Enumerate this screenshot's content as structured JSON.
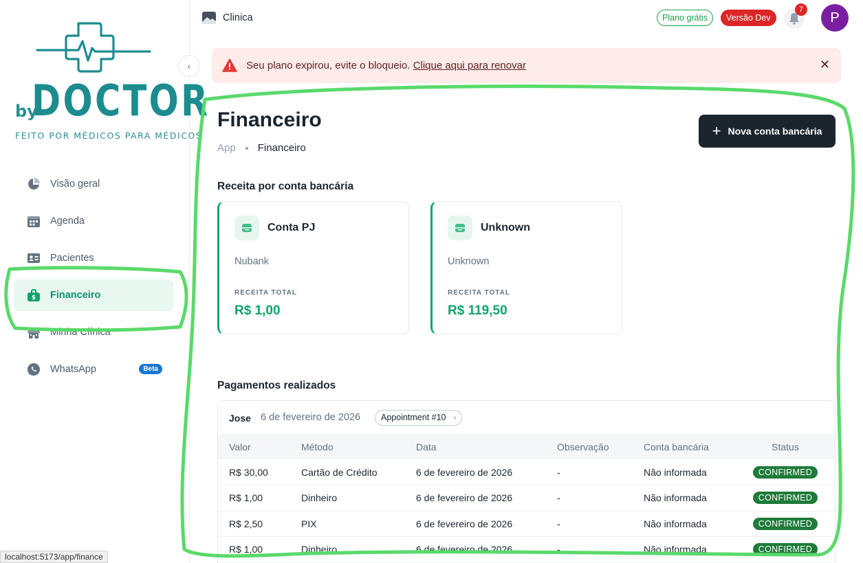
{
  "brand": {
    "by": "by",
    "name": "DOCTOR",
    "tagline": "FEITO POR MÉDICOS PARA MÉDICOS"
  },
  "sidebar": {
    "items": [
      {
        "label": "Visão geral",
        "icon": "pie-chart-icon"
      },
      {
        "label": "Agenda",
        "icon": "calendar-icon"
      },
      {
        "label": "Pacientes",
        "icon": "id-card-icon"
      },
      {
        "label": "Financeiro",
        "icon": "money-bag-icon",
        "active": true
      },
      {
        "label": "Minha Clínica",
        "icon": "building-icon"
      },
      {
        "label": "WhatsApp",
        "icon": "whatsapp-icon",
        "badge": "Beta"
      }
    ]
  },
  "topbar": {
    "clinic_name": "Clinica",
    "plan_badge": "Plano grátis",
    "dev_badge": "Versão Dev",
    "notifications_count": "7",
    "avatar_initial": "P"
  },
  "alert": {
    "text": "Seu plano expirou, evite o bloqueio.",
    "link": "Clique aqui para renovar"
  },
  "page": {
    "title": "Financeiro",
    "breadcrumb": [
      "App",
      "Financeiro"
    ],
    "new_account_button": "Nova conta bancária"
  },
  "revenue": {
    "section_title": "Receita por conta bancária",
    "caption": "RECEITA TOTAL",
    "accounts": [
      {
        "name": "Conta PJ",
        "bank": "Nubank",
        "total": "R$ 1,00"
      },
      {
        "name": "Unknown",
        "bank": "Unknown",
        "total": "R$ 119,50"
      }
    ]
  },
  "payments": {
    "section_title": "Pagamentos realizados",
    "patient": "Jose",
    "date": "6 de fevereiro de 2026",
    "appointment_chip": "Appointment #10",
    "columns": [
      "Valor",
      "Método",
      "Data",
      "Observação",
      "Conta bancária",
      "Status"
    ],
    "rows": [
      {
        "valor": "R$ 30,00",
        "metodo": "Cartão de Crédito",
        "data": "6 de fevereiro de 2026",
        "obs": "-",
        "conta": "Não informada",
        "status": "CONFIRMED"
      },
      {
        "valor": "R$ 1,00",
        "metodo": "Dinheiro",
        "data": "6 de fevereiro de 2026",
        "obs": "-",
        "conta": "Não informada",
        "status": "CONFIRMED"
      },
      {
        "valor": "R$ 2,50",
        "metodo": "PIX",
        "data": "6 de fevereiro de 2026",
        "obs": "-",
        "conta": "Não informada",
        "status": "CONFIRMED"
      },
      {
        "valor": "R$ 1,00",
        "metodo": "Dinheiro",
        "data": "6 de fevereiro de 2026",
        "obs": "-",
        "conta": "Não informada",
        "status": "CONFIRMED"
      }
    ]
  },
  "status_bar_url": "localhost:5173/app/finance",
  "colors": {
    "brand_teal": "#1d8c8e",
    "accent_green": "#10a36b",
    "status_confirmed": "#1e7b3a",
    "alert_bg": "#fdecea",
    "danger": "#dc2626",
    "avatar": "#7b1fa2",
    "annotation_green": "#5ad96b"
  }
}
